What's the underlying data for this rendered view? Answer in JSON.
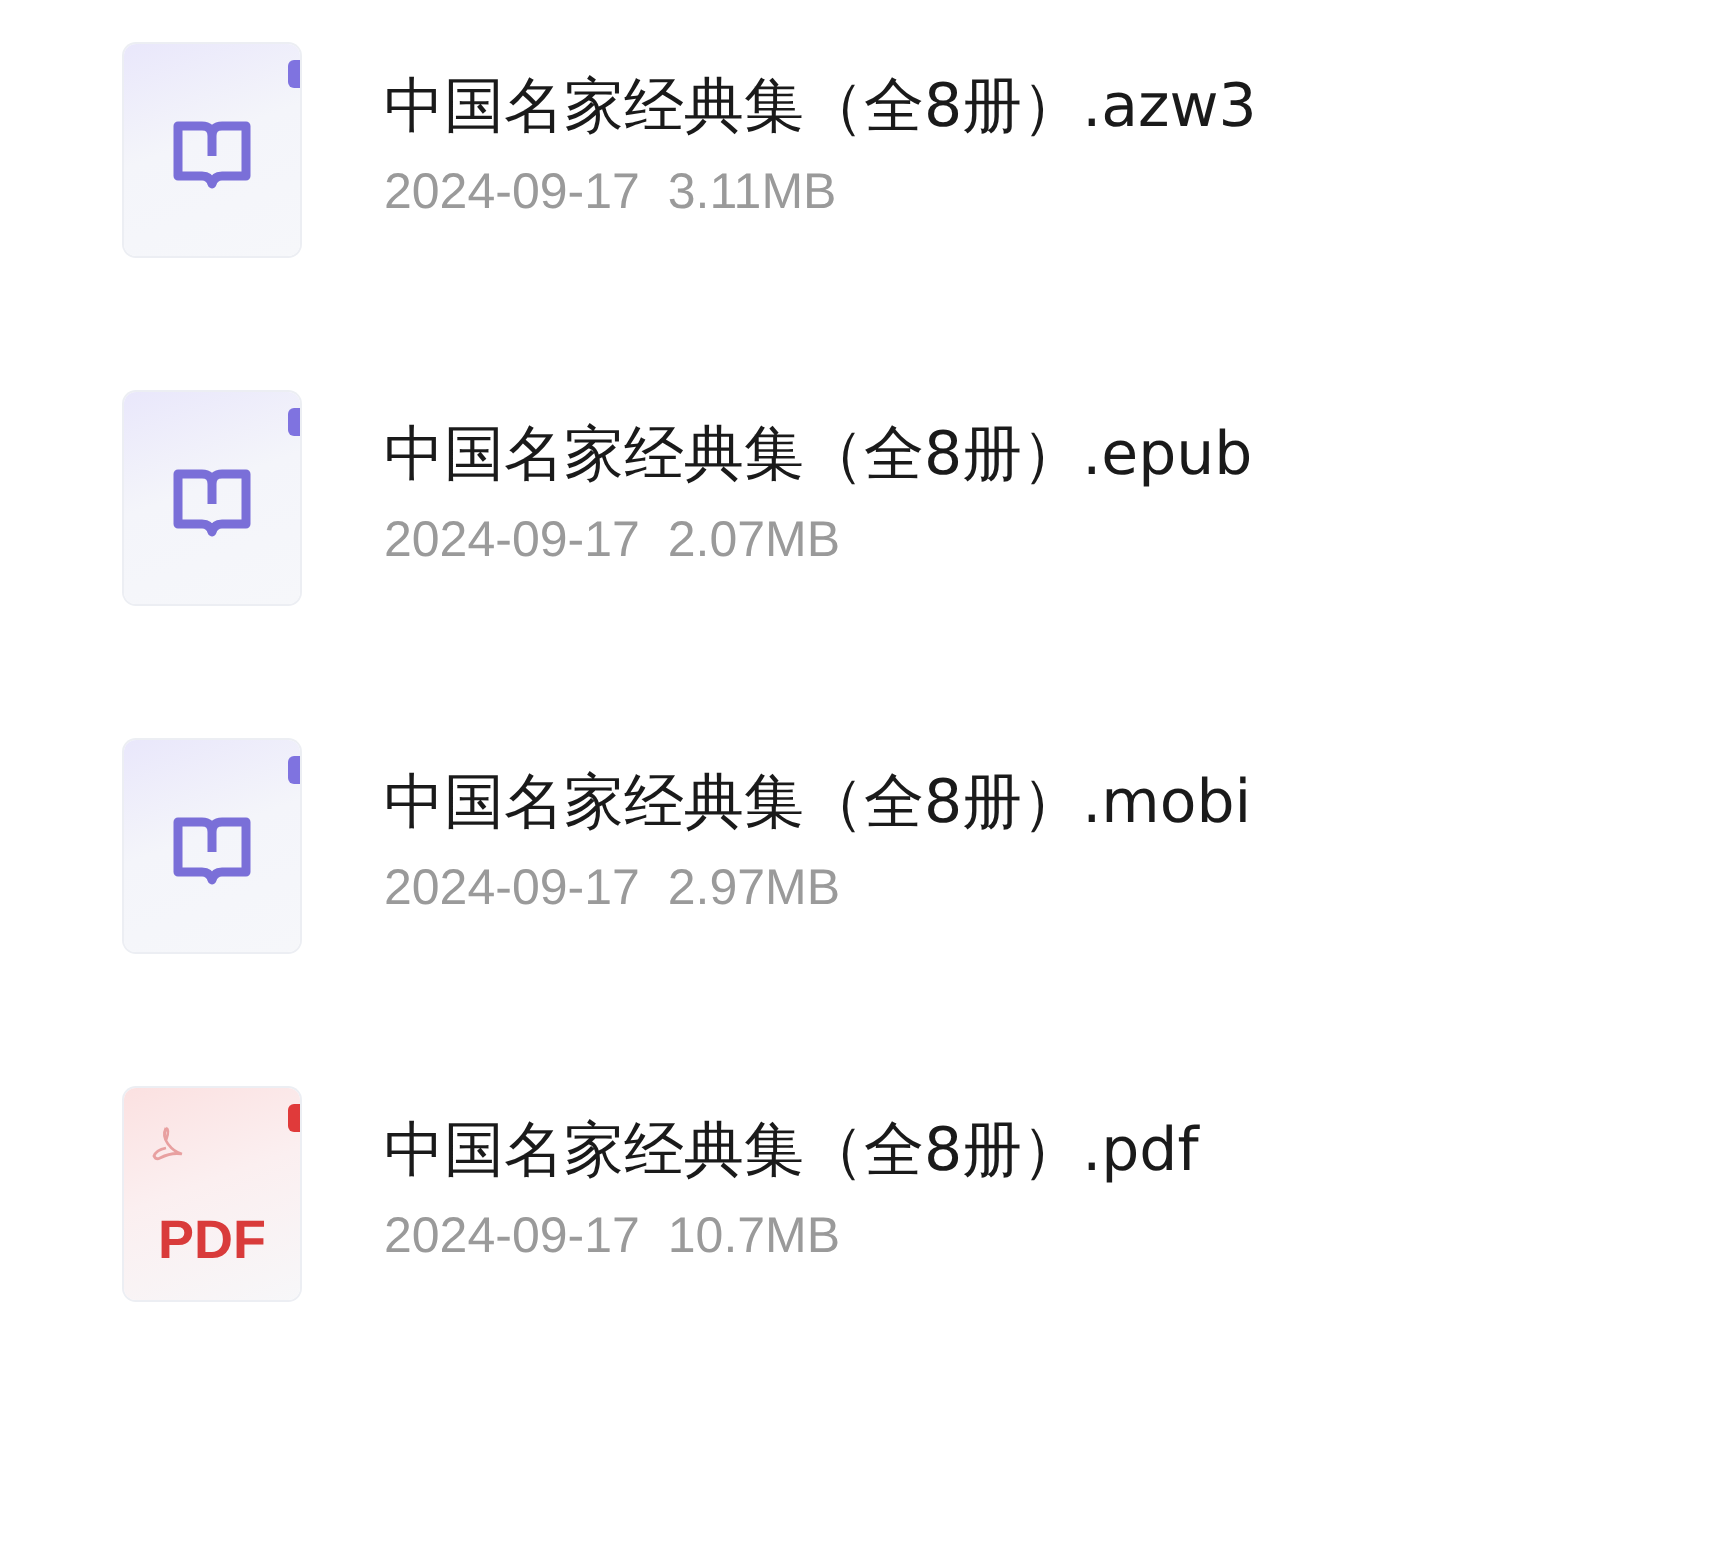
{
  "files": [
    {
      "kind": "ebook",
      "name": "中国名家经典集（全8册）.azw3",
      "date": "2024-09-17",
      "size": "3.11MB"
    },
    {
      "kind": "ebook",
      "name": "中国名家经典集（全8册）.epub",
      "date": "2024-09-17",
      "size": "2.07MB"
    },
    {
      "kind": "ebook",
      "name": "中国名家经典集（全8册）.mobi",
      "date": "2024-09-17",
      "size": "2.97MB"
    },
    {
      "kind": "pdf",
      "badge": "PDF",
      "name": "中国名家经典集（全8册）.pdf",
      "date": "2024-09-17",
      "size": "10.7MB"
    }
  ]
}
